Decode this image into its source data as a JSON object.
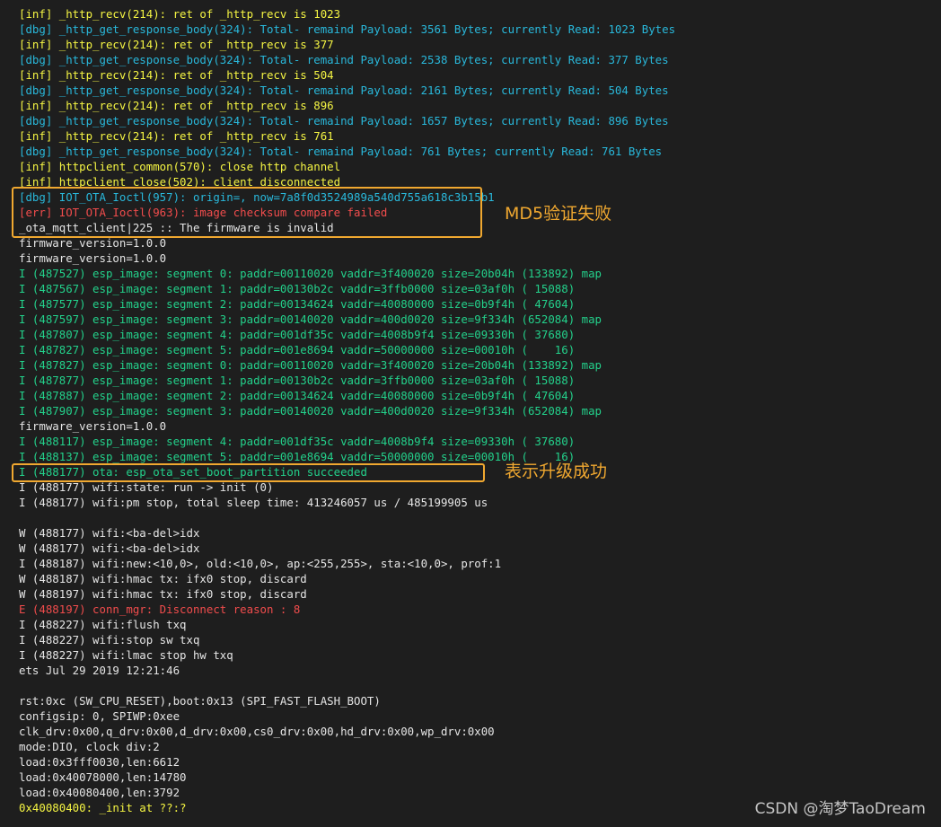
{
  "log_lines": [
    {
      "color": "yellow",
      "text": "[inf] _http_recv(214): ret of _http_recv is 1023"
    },
    {
      "color": "cyan",
      "text": "[dbg] _http_get_response_body(324): Total- remaind Payload: 3561 Bytes; currently Read: 1023 Bytes"
    },
    {
      "color": "yellow",
      "text": "[inf] _http_recv(214): ret of _http_recv is 377"
    },
    {
      "color": "cyan",
      "text": "[dbg] _http_get_response_body(324): Total- remaind Payload: 2538 Bytes; currently Read: 377 Bytes"
    },
    {
      "color": "yellow",
      "text": "[inf] _http_recv(214): ret of _http_recv is 504"
    },
    {
      "color": "cyan",
      "text": "[dbg] _http_get_response_body(324): Total- remaind Payload: 2161 Bytes; currently Read: 504 Bytes"
    },
    {
      "color": "yellow",
      "text": "[inf] _http_recv(214): ret of _http_recv is 896"
    },
    {
      "color": "cyan",
      "text": "[dbg] _http_get_response_body(324): Total- remaind Payload: 1657 Bytes; currently Read: 896 Bytes"
    },
    {
      "color": "yellow",
      "text": "[inf] _http_recv(214): ret of _http_recv is 761"
    },
    {
      "color": "cyan",
      "text": "[dbg] _http_get_response_body(324): Total- remaind Payload: 761 Bytes; currently Read: 761 Bytes"
    },
    {
      "color": "yellow",
      "text": "[inf] httpclient_common(570): close http channel"
    },
    {
      "color": "yellow",
      "text": "[inf] httpclient_close(502): client disconnected"
    },
    {
      "color": "cyan",
      "text": "[dbg] IOT_OTA_Ioctl(957): origin=, now=7a8f0d3524989a540d755a618c3b15b1"
    },
    {
      "color": "red",
      "text": "[err] IOT_OTA_Ioctl(963): image checksum compare failed"
    },
    {
      "color": "white",
      "text": "_ota_mqtt_client|225 :: The firmware is invalid"
    },
    {
      "color": "white",
      "text": "firmware_version=1.0.0"
    },
    {
      "color": "white",
      "text": "firmware_version=1.0.0"
    },
    {
      "color": "green",
      "text": "I (487527) esp_image: segment 0: paddr=00110020 vaddr=3f400020 size=20b04h (133892) map"
    },
    {
      "color": "green",
      "text": "I (487567) esp_image: segment 1: paddr=00130b2c vaddr=3ffb0000 size=03af0h ( 15088)"
    },
    {
      "color": "green",
      "text": "I (487577) esp_image: segment 2: paddr=00134624 vaddr=40080000 size=0b9f4h ( 47604)"
    },
    {
      "color": "green",
      "text": "I (487597) esp_image: segment 3: paddr=00140020 vaddr=400d0020 size=9f334h (652084) map"
    },
    {
      "color": "green",
      "text": "I (487807) esp_image: segment 4: paddr=001df35c vaddr=4008b9f4 size=09330h ( 37680)"
    },
    {
      "color": "green",
      "text": "I (487827) esp_image: segment 5: paddr=001e8694 vaddr=50000000 size=00010h (    16)"
    },
    {
      "color": "green",
      "text": "I (487827) esp_image: segment 0: paddr=00110020 vaddr=3f400020 size=20b04h (133892) map"
    },
    {
      "color": "green",
      "text": "I (487877) esp_image: segment 1: paddr=00130b2c vaddr=3ffb0000 size=03af0h ( 15088)"
    },
    {
      "color": "green",
      "text": "I (487887) esp_image: segment 2: paddr=00134624 vaddr=40080000 size=0b9f4h ( 47604)"
    },
    {
      "color": "green",
      "text": "I (487907) esp_image: segment 3: paddr=00140020 vaddr=400d0020 size=9f334h (652084) map"
    },
    {
      "color": "white",
      "text": "firmware_version=1.0.0"
    },
    {
      "color": "green",
      "text": "I (488117) esp_image: segment 4: paddr=001df35c vaddr=4008b9f4 size=09330h ( 37680)"
    },
    {
      "color": "green",
      "text": "I (488137) esp_image: segment 5: paddr=001e8694 vaddr=50000000 size=00010h (    16)"
    },
    {
      "color": "green",
      "text": "I (488177) ota: esp_ota_set_boot_partition succeeded"
    },
    {
      "color": "white",
      "text": "I (488177) wifi:state: run -> init (0)"
    },
    {
      "color": "white",
      "text": "I (488177) wifi:pm stop, total sleep time: 413246057 us / 485199905 us"
    },
    {
      "color": "white",
      "text": ""
    },
    {
      "color": "white",
      "text": "W (488177) wifi:<ba-del>idx"
    },
    {
      "color": "white",
      "text": "W (488177) wifi:<ba-del>idx"
    },
    {
      "color": "white",
      "text": "I (488187) wifi:new:<10,0>, old:<10,0>, ap:<255,255>, sta:<10,0>, prof:1"
    },
    {
      "color": "white",
      "text": "W (488187) wifi:hmac tx: ifx0 stop, discard"
    },
    {
      "color": "white",
      "text": "W (488197) wifi:hmac tx: ifx0 stop, discard"
    },
    {
      "color": "red",
      "text": "E (488197) conn_mgr: Disconnect reason : 8"
    },
    {
      "color": "white",
      "text": "I (488227) wifi:flush txq"
    },
    {
      "color": "white",
      "text": "I (488227) wifi:stop sw txq"
    },
    {
      "color": "white",
      "text": "I (488227) wifi:lmac stop hw txq"
    },
    {
      "color": "white",
      "text": "ets Jul 29 2019 12:21:46"
    },
    {
      "color": "white",
      "text": ""
    },
    {
      "color": "white",
      "text": "rst:0xc (SW_CPU_RESET),boot:0x13 (SPI_FAST_FLASH_BOOT)"
    },
    {
      "color": "white",
      "text": "configsip: 0, SPIWP:0xee"
    },
    {
      "color": "white",
      "text": "clk_drv:0x00,q_drv:0x00,d_drv:0x00,cs0_drv:0x00,hd_drv:0x00,wp_drv:0x00"
    },
    {
      "color": "white",
      "text": "mode:DIO, clock div:2"
    },
    {
      "color": "white",
      "text": "load:0x3fff0030,len:6612"
    },
    {
      "color": "white",
      "text": "load:0x40078000,len:14780"
    },
    {
      "color": "white",
      "text": "load:0x40080400,len:3792"
    },
    {
      "color": "yellow",
      "text": "0x40080400: _init at ??:?"
    }
  ],
  "annotations": {
    "md5_failed": "MD5验证失败",
    "upgrade_success": "表示升级成功"
  },
  "watermark": "CSDN @淘梦TaoDream",
  "colors": {
    "background": "#1e1e1e",
    "inf": "#f5f543",
    "dbg": "#29b8db",
    "err": "#f14c4c",
    "esp_info": "#23d18b",
    "plain": "#e5e5e5",
    "highlight": "#f0a830"
  }
}
